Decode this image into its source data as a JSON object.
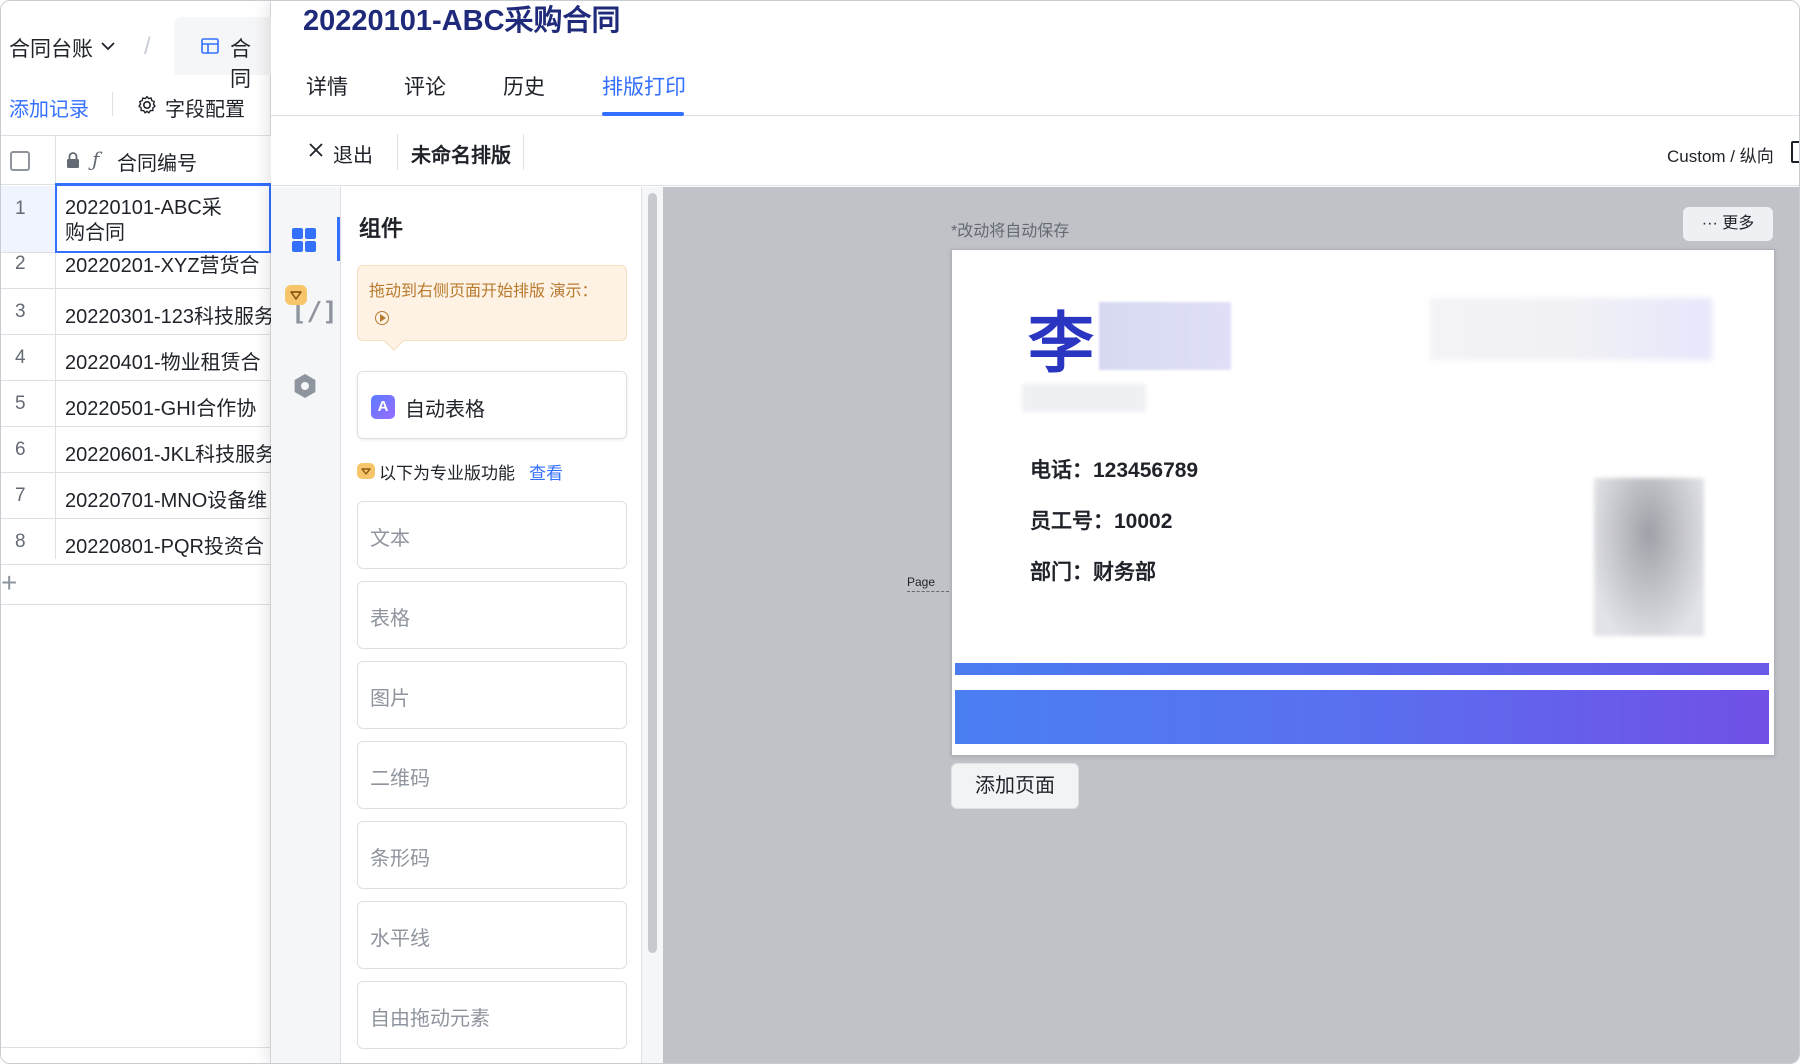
{
  "sheet": {
    "title": "合同台账",
    "tab_label": "合同",
    "add_record": "添加记录",
    "field_config": "字段配置",
    "column_header": "合同编号",
    "rows": [
      {
        "num": "1",
        "value": "20220101-ABC采购合同"
      },
      {
        "num": "2",
        "value": "20220201-XYZ营货合"
      },
      {
        "num": "3",
        "value": "20220301-123科技服务"
      },
      {
        "num": "4",
        "value": "20220401-物业租赁合"
      },
      {
        "num": "5",
        "value": "20220501-GHI合作协"
      },
      {
        "num": "6",
        "value": "20220601-JKL科技服务"
      },
      {
        "num": "7",
        "value": "20220701-MNO设备维"
      },
      {
        "num": "8",
        "value": "20220801-PQR投资合"
      }
    ],
    "add_row": "+"
  },
  "panel": {
    "title": "20220101-ABC采购合同",
    "tabs": [
      "详情",
      "评论",
      "历史",
      "排版打印"
    ],
    "active_tab": "排版打印",
    "exit": "退出",
    "layout_name": "未命名排版",
    "page_size": "Custom / 纵向"
  },
  "components": {
    "title": "组件",
    "tip": "拖动到右侧页面开始排版 演示：",
    "auto_table": "自动表格",
    "pro_notice": "以下为专业版功能",
    "pro_link": "查看",
    "items": [
      "文本",
      "表格",
      "图片",
      "二维码",
      "条形码",
      "水平线",
      "自由拖动元素"
    ]
  },
  "canvas": {
    "autosave": "*改动将自动保存",
    "more": "··· 更多",
    "page_label": "Page",
    "add_page": "添加页面",
    "badge": {
      "surname": "李",
      "phone": "电话：123456789",
      "employee_id": "员工号：10002",
      "department": "部门：财务部"
    }
  },
  "colors": {
    "accent": "#3370ff",
    "title": "#1f2b7a",
    "surname": "#2a35c2",
    "band_start": "#4a7ff2",
    "band_end": "#7150e6",
    "canvas_bg": "#c0c2c7"
  }
}
